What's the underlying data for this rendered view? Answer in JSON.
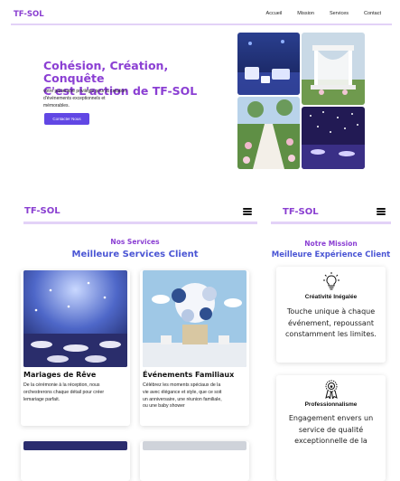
{
  "desktop": {
    "brand": "TF-SOL",
    "nav": [
      "Accueil",
      "Mission",
      "Services",
      "Contact"
    ],
    "hero": {
      "title_line1": "Cohésion, Création, Conquête",
      "title_line2": "C'est L'action de TF-SOL",
      "desc_line1": "votre partenaire privilégié pour la création",
      "desc_line2": "d'événements exceptionnels et",
      "desc_line3": "mémorables.",
      "button": "Contacter Nous"
    }
  },
  "services_panel": {
    "brand": "TF-SOL",
    "kicker": "Nos Services",
    "title": "Meilleure Services Client",
    "cards": [
      {
        "title": "Mariages de Rêve",
        "desc_lines": [
          "De la cérémonie à la réception, nous",
          "orchestrerons chaque détail pour créer",
          "lemariage parfait."
        ]
      },
      {
        "title": "Événements Familiaux",
        "desc_lines": [
          "Célébrez les moments spéciaux de la",
          "vie avec élégance et style, que ce soit",
          "un anniversaire, une réunion familiale,",
          "ou une baby shower"
        ]
      }
    ]
  },
  "mission_panel": {
    "brand": "TF-SOL",
    "kicker": "Notre Mission",
    "title": "Meilleure Expérience Client",
    "cards": [
      {
        "icon": "lightbulb-icon",
        "title": "Créativité Inégalée",
        "desc_lines": [
          "Touche unique à chaque",
          "événement, repoussant",
          "constamment les limites."
        ]
      },
      {
        "icon": "award-ribbon-icon",
        "title": "Professionnalisme",
        "desc_lines": [
          "Engagement envers un",
          "service de qualité",
          "exceptionnelle de la"
        ]
      }
    ]
  },
  "colors": {
    "brand": "#8a3fd1",
    "title_blue": "#4a55d4",
    "button": "#6147e4",
    "header_rule": "#e3d2f7"
  }
}
